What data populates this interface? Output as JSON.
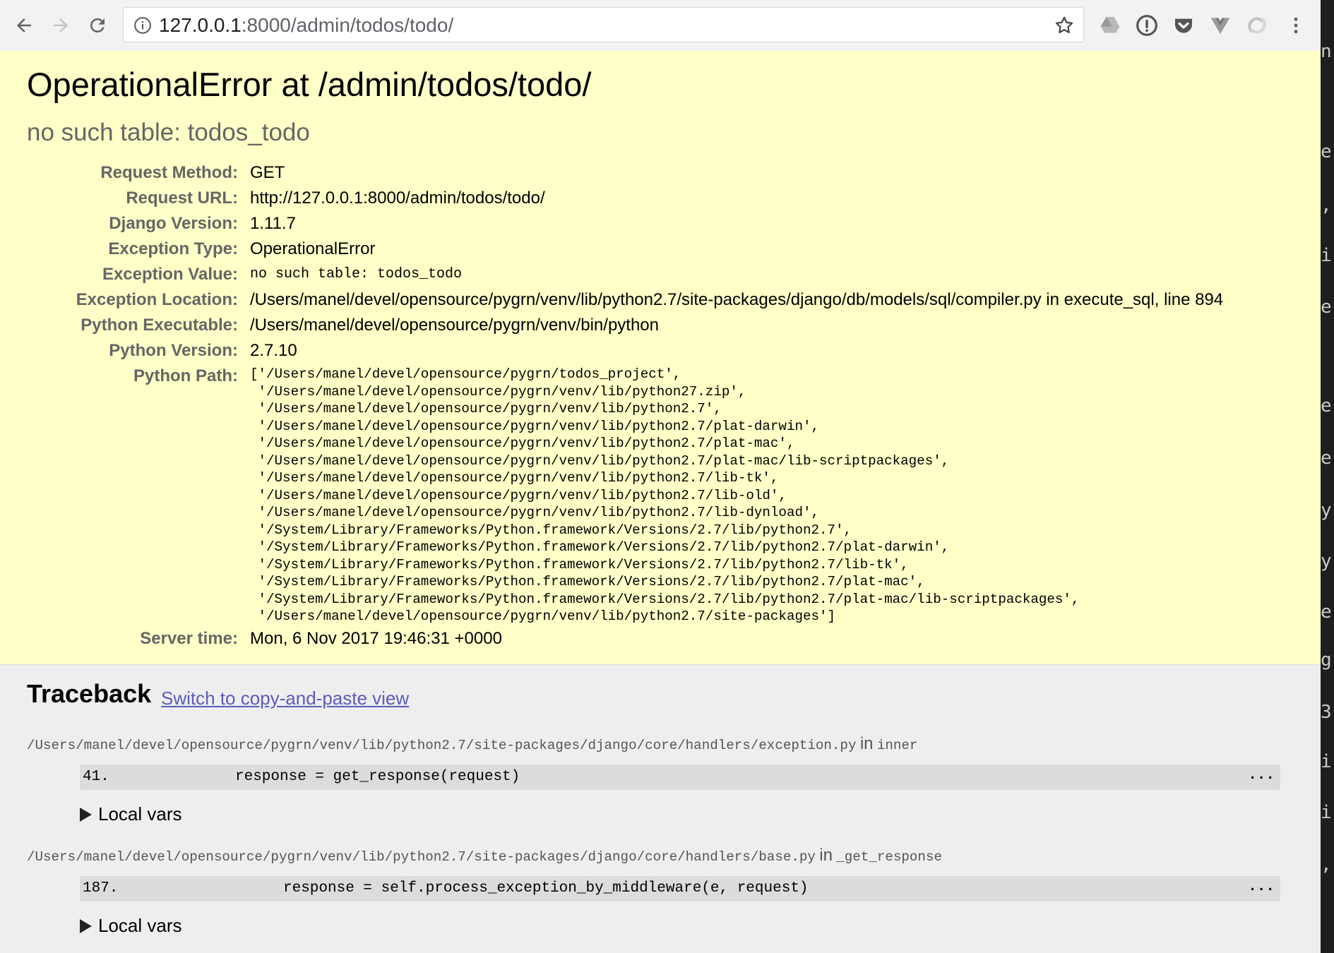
{
  "browser": {
    "url_host": "127.0.0.1",
    "url_rest": ":8000/admin/todos/todo/"
  },
  "error": {
    "title": "OperationalError at /admin/todos/todo/",
    "subtitle": "no such table: todos_todo"
  },
  "meta": [
    {
      "label": "Request Method:",
      "value": "GET"
    },
    {
      "label": "Request URL:",
      "value": "http://127.0.0.1:8000/admin/todos/todo/"
    },
    {
      "label": "Django Version:",
      "value": "1.11.7"
    },
    {
      "label": "Exception Type:",
      "value": "OperationalError"
    },
    {
      "label": "Exception Value:",
      "value": "no such table: todos_todo"
    },
    {
      "label": "Exception Location:",
      "value": "/Users/manel/devel/opensource/pygrn/venv/lib/python2.7/site-packages/django/db/models/sql/compiler.py in execute_sql, line 894"
    },
    {
      "label": "Python Executable:",
      "value": "/Users/manel/devel/opensource/pygrn/venv/bin/python"
    },
    {
      "label": "Python Version:",
      "value": "2.7.10"
    },
    {
      "label": "Python Path:",
      "value": "['/Users/manel/devel/opensource/pygrn/todos_project',\n '/Users/manel/devel/opensource/pygrn/venv/lib/python27.zip',\n '/Users/manel/devel/opensource/pygrn/venv/lib/python2.7',\n '/Users/manel/devel/opensource/pygrn/venv/lib/python2.7/plat-darwin',\n '/Users/manel/devel/opensource/pygrn/venv/lib/python2.7/plat-mac',\n '/Users/manel/devel/opensource/pygrn/venv/lib/python2.7/plat-mac/lib-scriptpackages',\n '/Users/manel/devel/opensource/pygrn/venv/lib/python2.7/lib-tk',\n '/Users/manel/devel/opensource/pygrn/venv/lib/python2.7/lib-old',\n '/Users/manel/devel/opensource/pygrn/venv/lib/python2.7/lib-dynload',\n '/System/Library/Frameworks/Python.framework/Versions/2.7/lib/python2.7',\n '/System/Library/Frameworks/Python.framework/Versions/2.7/lib/python2.7/plat-darwin',\n '/System/Library/Frameworks/Python.framework/Versions/2.7/lib/python2.7/lib-tk',\n '/System/Library/Frameworks/Python.framework/Versions/2.7/lib/python2.7/plat-mac',\n '/System/Library/Frameworks/Python.framework/Versions/2.7/lib/python2.7/plat-mac/lib-scriptpackages',\n '/Users/manel/devel/opensource/pygrn/venv/lib/python2.7/site-packages']"
    },
    {
      "label": "Server time:",
      "value": "Mon, 6 Nov 2017 19:46:31 +0000"
    }
  ],
  "traceback": {
    "heading": "Traceback",
    "switch_link": "Switch to copy-and-paste view",
    "frames": [
      {
        "file": "/Users/manel/devel/opensource/pygrn/venv/lib/python2.7/site-packages/django/core/handlers/exception.py",
        "in_word": "in",
        "function": "inner",
        "line_no": "41.",
        "code": "response = get_response(request)",
        "dots": "...",
        "local_vars": "Local vars"
      },
      {
        "file": "/Users/manel/devel/opensource/pygrn/venv/lib/python2.7/site-packages/django/core/handlers/base.py",
        "in_word": "in",
        "function": "_get_response",
        "line_no": "187.",
        "code": "response = self.process_exception_by_middleware(e, request)",
        "dots": "...",
        "local_vars": "Local vars"
      }
    ]
  },
  "editor_strip": [
    "n",
    "e",
    ",",
    "i",
    "e",
    "e",
    "e",
    "y",
    "y",
    "e",
    "g",
    "3",
    "i",
    "i",
    ","
  ]
}
